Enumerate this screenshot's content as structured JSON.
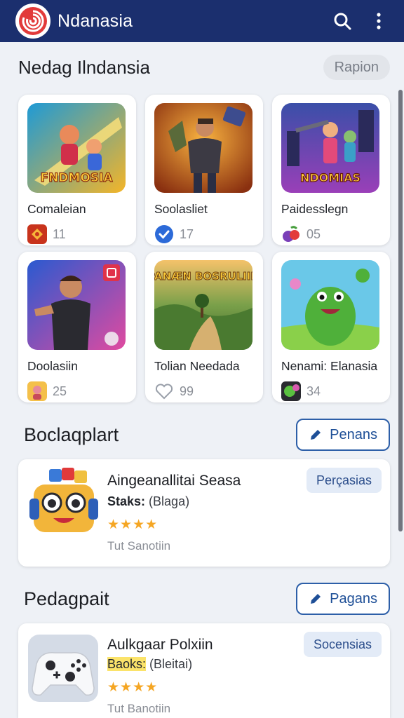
{
  "app": {
    "title": "Ndanasia",
    "brand_color": "#1b2f6e",
    "logo_icon": "swirl-logo-icon"
  },
  "toolbar": {
    "search_icon": "search-icon",
    "menu_icon": "more-vert-icon"
  },
  "section1": {
    "title": "Nedag Ilndansia",
    "button": "Rapion"
  },
  "games": [
    {
      "name": "Comaleian",
      "count": "11",
      "art_text": "FNDMOSIA",
      "badge_icon": "red-emblem-icon"
    },
    {
      "name": "Soolasliet",
      "count": "17",
      "badge_icon": "check-badge-icon"
    },
    {
      "name": "Paidesslegn",
      "count": "05",
      "art_text": "NDOMIAS",
      "badge_icon": "fruit-icon"
    },
    {
      "name": "Doolasiin",
      "count": "25",
      "badge_icon": "character-icon"
    },
    {
      "name": "Tolian Needada",
      "count": "99",
      "art_text": "PANÆN BOSRULIIN",
      "badge_icon": "heart-icon"
    },
    {
      "name": "Nenami: Elanasia",
      "count": "34",
      "badge_icon": "alien-icon"
    }
  ],
  "section2": {
    "title": "Boclaqplart",
    "button": "Penans"
  },
  "card1": {
    "title": "Aingeanallitai Seasa",
    "sub_key": "Staks:",
    "sub_val": "(Blaga)",
    "stars": "★★★★",
    "footer": "Tut Sanotiin",
    "tag": "Perçasias"
  },
  "section3": {
    "title": "Pedagpait",
    "button": "Pagans"
  },
  "card2": {
    "title": "Aulkgaar Polxiin",
    "sub_key": "Baoks:",
    "sub_val": "(Bleitai)",
    "stars": "★★★★",
    "footer": "Tut Banotiin",
    "tag": "Socensias"
  }
}
